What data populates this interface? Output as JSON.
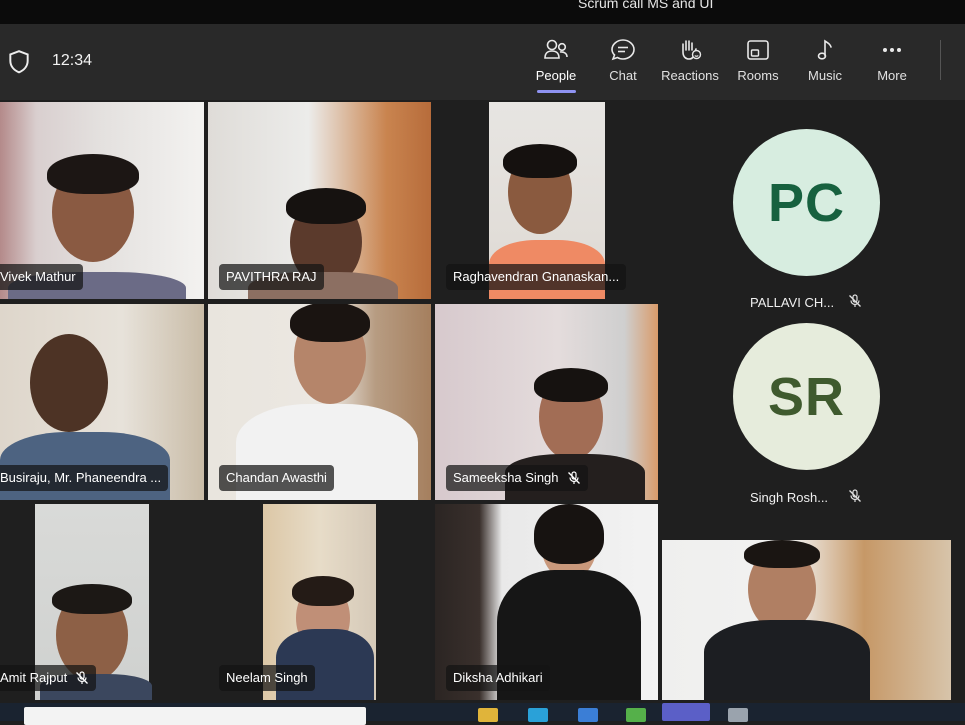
{
  "meeting": {
    "title": "Scrum call MS and UI"
  },
  "toolbar": {
    "time": "12:34",
    "buttons": [
      {
        "label": "People",
        "icon": "people-icon"
      },
      {
        "label": "Chat",
        "icon": "chat-icon"
      },
      {
        "label": "Reactions",
        "icon": "reactions-icon"
      },
      {
        "label": "Rooms",
        "icon": "rooms-icon"
      },
      {
        "label": "Music",
        "icon": "music-icon"
      },
      {
        "label": "More",
        "icon": "more-icon"
      }
    ]
  },
  "participants": [
    {
      "name": "Vivek Mathur",
      "muted": false
    },
    {
      "name": "PAVITHRA RAJ",
      "muted": false
    },
    {
      "name": "Raghavendran Gnanaskan...",
      "muted": false
    },
    {
      "name": "Busiraju, Mr. Phaneendra ...",
      "muted": false,
      "active_speaker": true
    },
    {
      "name": "Chandan Awasthi",
      "muted": false
    },
    {
      "name": "Sameeksha Singh",
      "muted": true
    },
    {
      "name": "Amit Rajput",
      "muted": true
    },
    {
      "name": "Neelam Singh",
      "muted": false
    },
    {
      "name": "Diksha Adhikari",
      "muted": false
    },
    {
      "name": "",
      "muted": false
    }
  ],
  "avatars": [
    {
      "initials": "PC",
      "name": "PALLAVI CH...",
      "muted": true,
      "bg": "#d7ede0",
      "fg": "#17613f"
    },
    {
      "initials": "SR",
      "name": "Singh Rosh...",
      "muted": true,
      "bg": "#e6ecdc",
      "fg": "#3f5a2e"
    }
  ],
  "colors": {
    "accent": "#8f93f2",
    "toolbar_bg": "#292929",
    "stage_bg": "#1f1f1f"
  }
}
